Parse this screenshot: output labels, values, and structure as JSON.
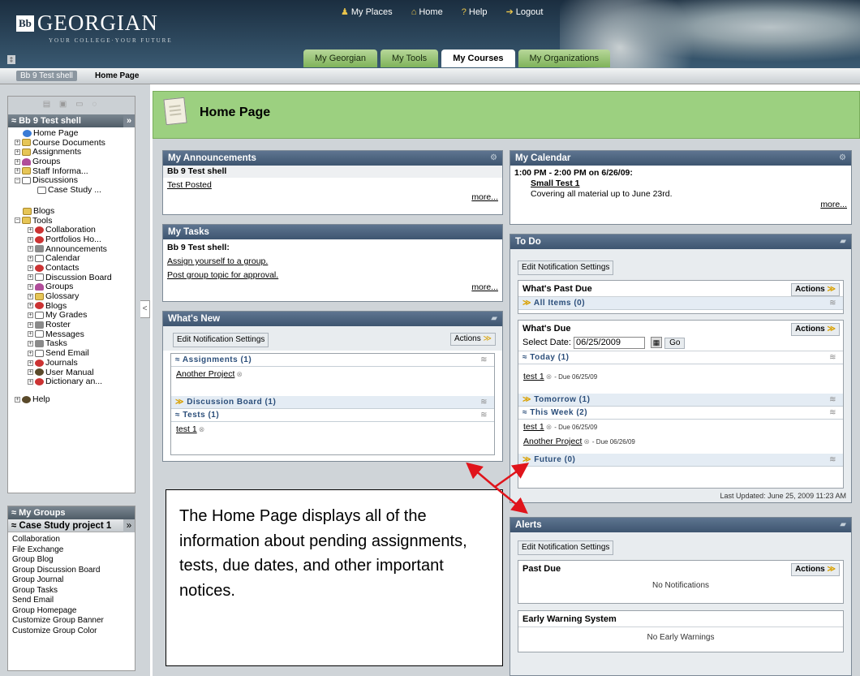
{
  "header": {
    "logo_badge": "Bb",
    "logo_name": "GEORGIAN",
    "logo_tagline": "YOUR COLLEGE·YOUR FUTURE",
    "links": [
      "My Places",
      "Home",
      "Help",
      "Logout"
    ],
    "tabs": [
      "My Georgian",
      "My Tools",
      "My Courses",
      "My Organizations"
    ],
    "active_tab": "My Courses"
  },
  "breadcrumb": {
    "course": "Bb 9 Test shell",
    "current": "Home Page"
  },
  "course_menu": {
    "title": "Bb 9 Test shell",
    "items": [
      {
        "label": "Home Page",
        "icon": "globe"
      },
      {
        "label": "Course Documents",
        "icon": "folder"
      },
      {
        "label": "Assignments",
        "icon": "folder"
      },
      {
        "label": "Groups",
        "icon": "people"
      },
      {
        "label": "Staff Informa...",
        "icon": "folder"
      },
      {
        "label": "Discussions",
        "icon": "doc"
      },
      {
        "label": "Case Study ...",
        "icon": "doc"
      },
      {
        "label": "",
        "icon": ""
      },
      {
        "label": "Blogs",
        "icon": "folder"
      },
      {
        "label": "Tools",
        "icon": "folder"
      },
      {
        "label": "Collaboration",
        "icon": "red"
      },
      {
        "label": "Portfolios Ho...",
        "icon": "red"
      },
      {
        "label": "Announcements",
        "icon": "gray"
      },
      {
        "label": "Calendar",
        "icon": "doc"
      },
      {
        "label": "Contacts",
        "icon": "red"
      },
      {
        "label": "Discussion Board",
        "icon": "doc"
      },
      {
        "label": "Groups",
        "icon": "people"
      },
      {
        "label": "Glossary",
        "icon": "folder"
      },
      {
        "label": "Blogs",
        "icon": "red"
      },
      {
        "label": "My Grades",
        "icon": "doc"
      },
      {
        "label": "Roster",
        "icon": "gray"
      },
      {
        "label": "Messages",
        "icon": "doc"
      },
      {
        "label": "Tasks",
        "icon": "gray"
      },
      {
        "label": "Send Email",
        "icon": "doc"
      },
      {
        "label": "Journals",
        "icon": "red"
      },
      {
        "label": "User Manual",
        "icon": "dark"
      },
      {
        "label": "Dictionary an...",
        "icon": "red"
      },
      {
        "label": "",
        "icon": ""
      },
      {
        "label": "Help",
        "icon": "dark"
      }
    ]
  },
  "my_groups": {
    "title": "My Groups",
    "group": "Case Study project 1",
    "links": [
      "Collaboration",
      "File Exchange",
      "Group Blog",
      "Group Discussion Board",
      "Group Journal",
      "Group Tasks",
      "Send Email",
      "Group Homepage",
      "Customize Group Banner",
      "Customize Group Color"
    ]
  },
  "page": {
    "title": "Home Page"
  },
  "announcements": {
    "title": "My Announcements",
    "course": "Bb 9 Test shell",
    "link": "Test Posted",
    "more": "more..."
  },
  "tasks": {
    "title": "My Tasks",
    "course": "Bb 9 Test shell:",
    "items": [
      "Assign yourself to a group.",
      "Post group topic for approval."
    ],
    "more": "more..."
  },
  "whats_new": {
    "title": "What's New",
    "edit": "Edit Notification Settings",
    "actions": "Actions",
    "cat_assignments": "Assignments (1)",
    "assignment_item": "Another Project",
    "cat_discussion": "Discussion Board (1)",
    "cat_tests": "Tests (1)",
    "test_item": "test 1"
  },
  "calendar": {
    "title": "My Calendar",
    "when": "1:00 PM - 2:00 PM on 6/26/09:",
    "event": "Small Test 1",
    "desc": "Covering all material up to June 23rd.",
    "more": "more..."
  },
  "todo": {
    "title": "To Do",
    "edit": "Edit Notification Settings",
    "past_due": "What's Past Due",
    "actions": "Actions",
    "all_items": "All Items (0)",
    "whats_due": "What's Due",
    "select_date_label": "Select Date:",
    "select_date_value": "06/25/2009",
    "go": "Go",
    "today": "Today (1)",
    "today_item": "test 1",
    "today_due": "- Due 06/25/09",
    "tomorrow": "Tomorrow (1)",
    "this_week": "This Week (2)",
    "week_item1": "test 1",
    "week_due1": "- Due 06/25/09",
    "week_item2": "Another Project",
    "week_due2": "- Due 06/26/09",
    "future": "Future (0)",
    "updated": "Last Updated: June 25, 2009 11:23 AM"
  },
  "alerts": {
    "title": "Alerts",
    "edit": "Edit Notification Settings",
    "past_due": "Past Due",
    "actions": "Actions",
    "none": "No Notifications",
    "ews": "Early Warning System",
    "ews_none": "No Early Warnings"
  },
  "callout": {
    "text": "The Home Page displays all of the information about pending assignments, tests, due dates, and other important notices."
  },
  "colors": {
    "accent_green": "#9cd080",
    "module_header": "#4e6680",
    "arrow": "#e0141b"
  }
}
